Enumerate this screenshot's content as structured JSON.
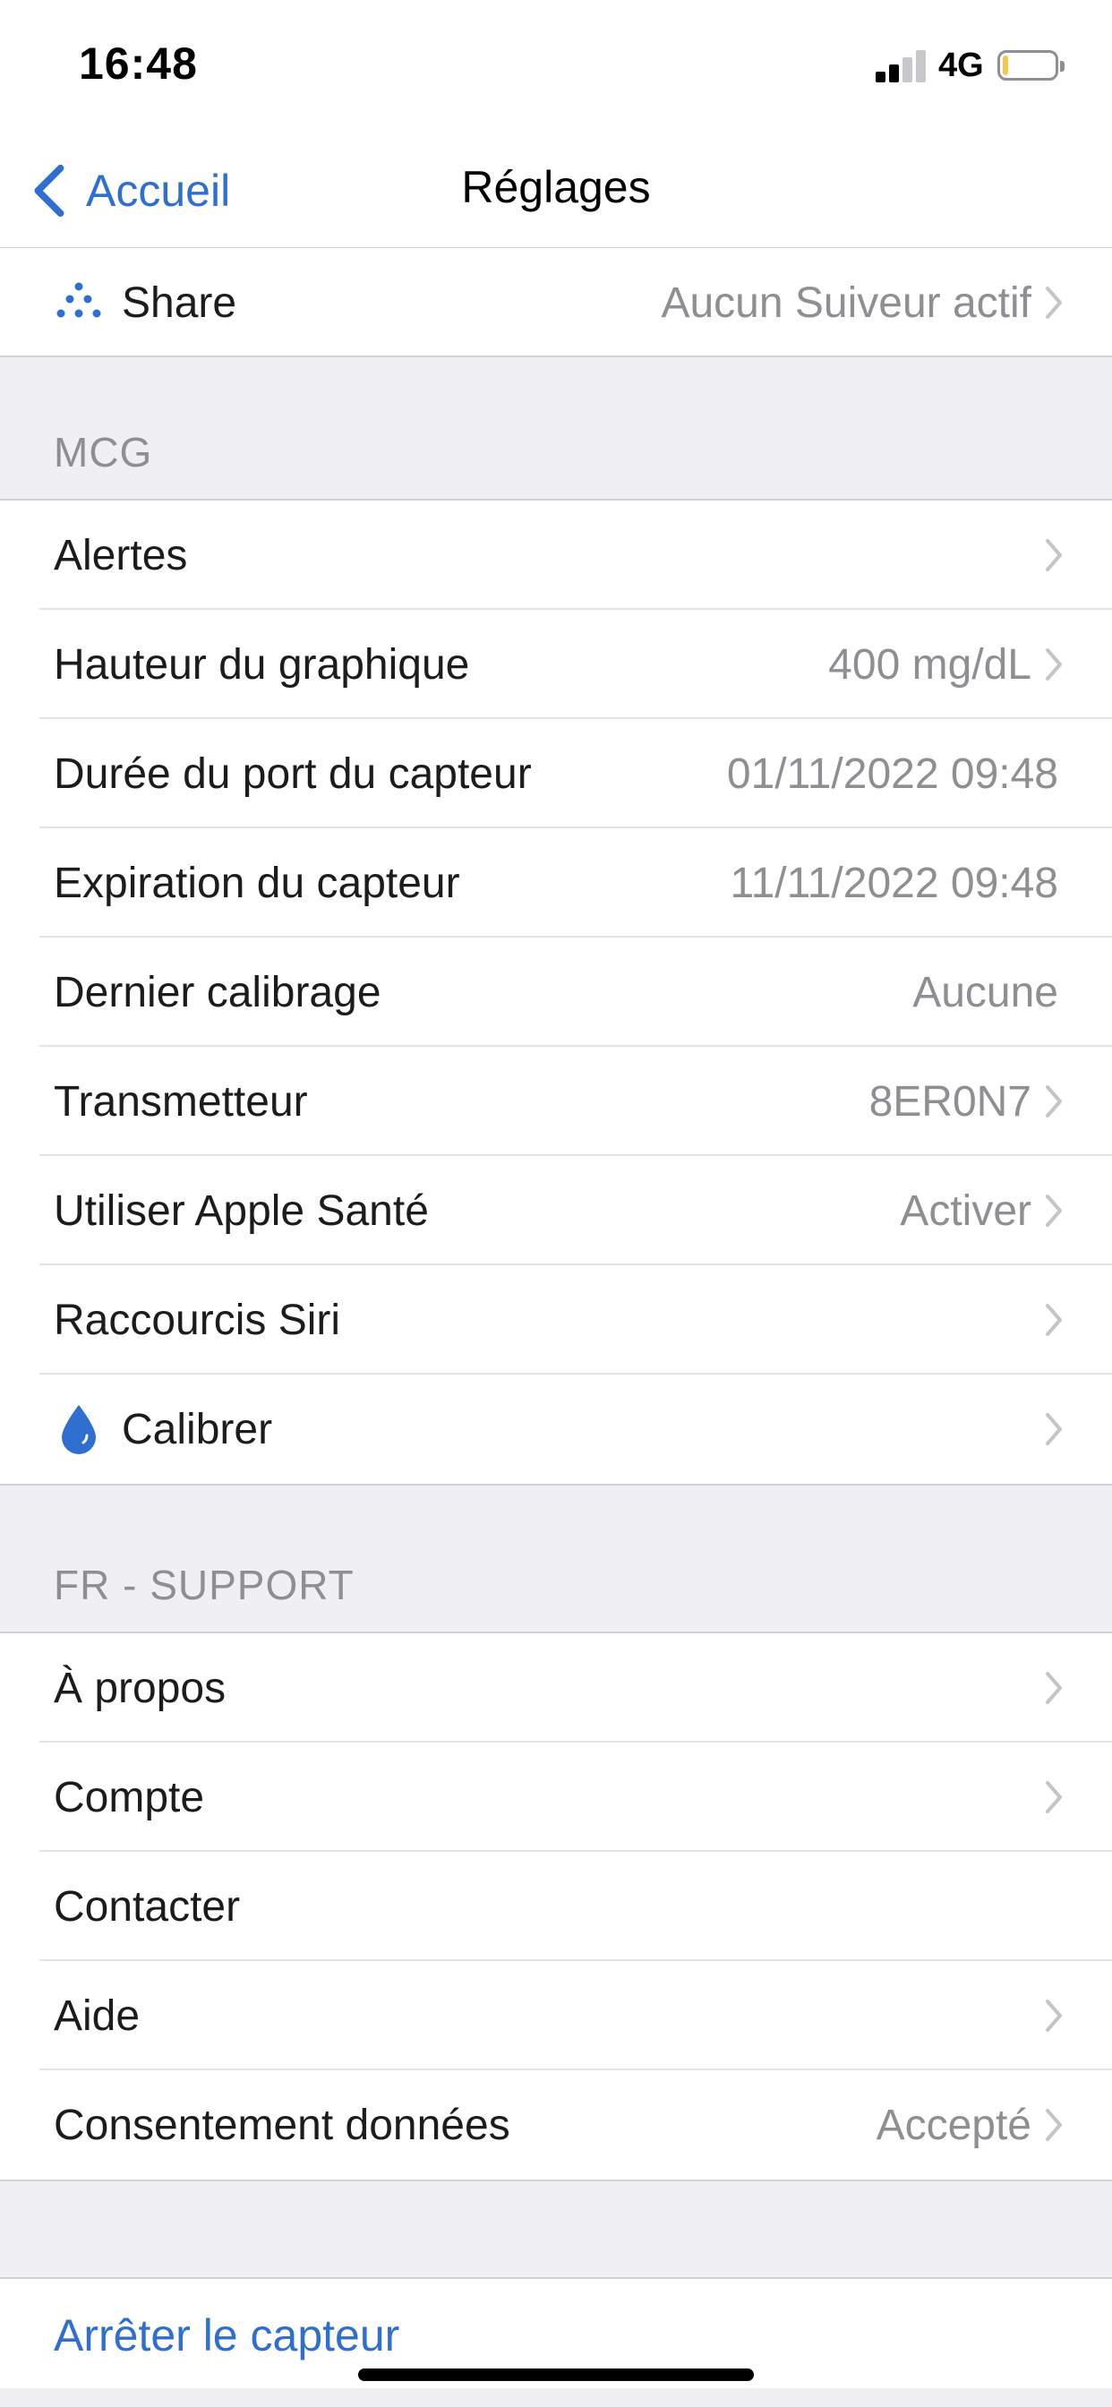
{
  "status_bar": {
    "time": "16:48",
    "network": "4G"
  },
  "nav": {
    "back_label": "Accueil",
    "title": "Réglages"
  },
  "share_row": {
    "label": "Share",
    "value": "Aucun Suiveur actif"
  },
  "mcg": {
    "header": "MCG",
    "rows": [
      {
        "label": "Alertes",
        "value": ""
      },
      {
        "label": "Hauteur du graphique",
        "value": "400 mg/dL"
      },
      {
        "label": "Durée du port du capteur",
        "value": "01/11/2022 09:48"
      },
      {
        "label": "Expiration du capteur",
        "value": "11/11/2022 09:48"
      },
      {
        "label": "Dernier calibrage",
        "value": "Aucune"
      },
      {
        "label": "Transmetteur",
        "value": "8ER0N7"
      },
      {
        "label": "Utiliser Apple Santé",
        "value": "Activer"
      },
      {
        "label": "Raccourcis Siri",
        "value": ""
      },
      {
        "label": "Calibrer",
        "value": ""
      }
    ]
  },
  "support": {
    "header": "FR - SUPPORT",
    "rows": [
      {
        "label": "À propos",
        "value": ""
      },
      {
        "label": "Compte",
        "value": ""
      },
      {
        "label": "Contacter",
        "value": ""
      },
      {
        "label": "Aide",
        "value": ""
      },
      {
        "label": "Consentement données",
        "value": "Accepté"
      }
    ]
  },
  "stop_sensor": {
    "label": "Arrêter le capteur"
  },
  "colors": {
    "accent": "#2f6fcf",
    "secondary_text": "#8e8e93",
    "background": "#efeff4"
  }
}
